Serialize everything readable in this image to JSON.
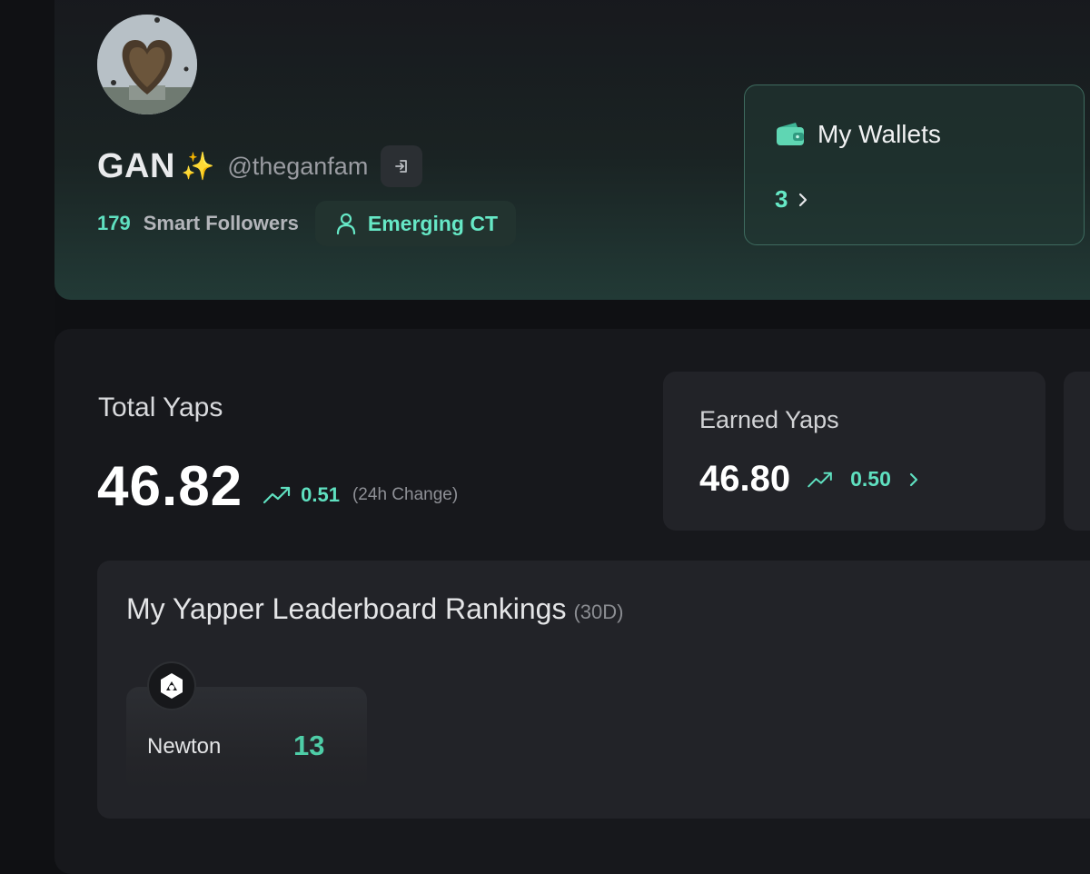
{
  "profile": {
    "display_name": "GAN",
    "name_emoji": "✨",
    "handle": "@theganfam",
    "smart_followers_count": "179",
    "smart_followers_label": "Smart Followers",
    "tier_label": "Emerging CT"
  },
  "wallets": {
    "title": "My Wallets",
    "count": "3"
  },
  "total_yaps": {
    "label": "Total Yaps",
    "value": "46.82",
    "change": "0.51",
    "change_note": "(24h Change)"
  },
  "earned_yaps": {
    "label": "Earned Yaps",
    "value": "46.80",
    "change": "0.50"
  },
  "leaderboard": {
    "title": "My Yapper Leaderboard Rankings",
    "period": "(30D)",
    "items": [
      {
        "name": "Newton",
        "rank": "13"
      }
    ]
  },
  "colors": {
    "accent": "#5fe0c0",
    "accent_bright": "#66e8c6",
    "rank_green": "#4ecda7",
    "background": "#0f1013"
  },
  "icons": {
    "link_button": "login-arrow-icon",
    "tier": "person-icon",
    "wallet": "wallet-icon",
    "change": "trend-up-icon",
    "chevron": "chevron-right-icon",
    "project_logo": "newton-logo-icon"
  }
}
